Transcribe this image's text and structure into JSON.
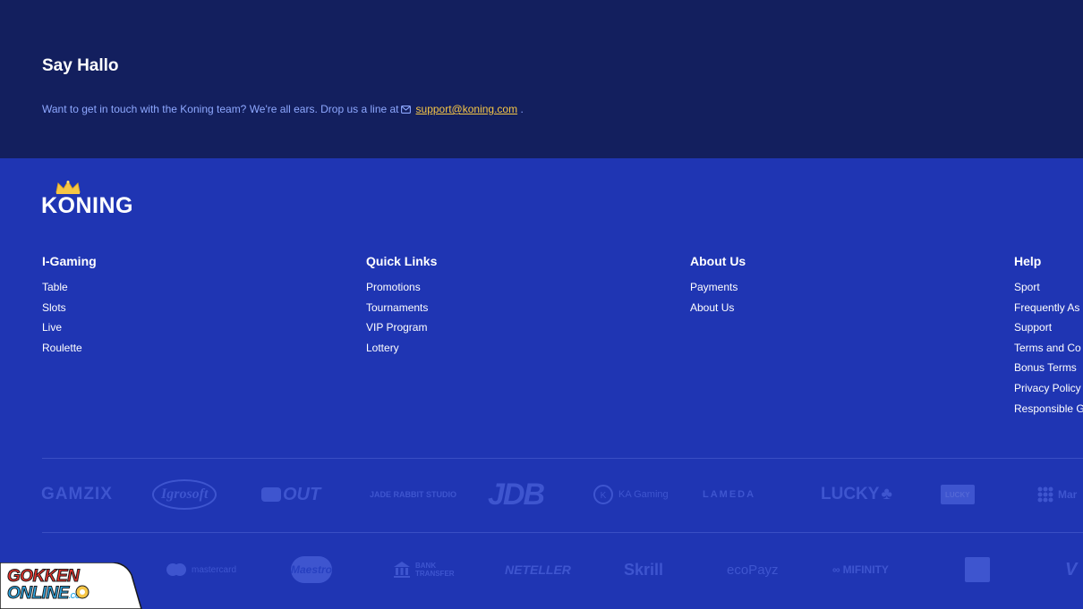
{
  "contact": {
    "title": "Say Hallo",
    "text": "Want to get in touch with the Koning team? We're all ears. Drop us a line at",
    "email": "support@koning.com",
    "suffix": "."
  },
  "brand": {
    "name": "KONING",
    "colors": {
      "dark_navy": "#131f5e",
      "footer_blue": "#1f35b3",
      "accent_gold": "#f6c646",
      "link_light": "#8ea8ff"
    }
  },
  "footer": {
    "columns": [
      {
        "title": "I-Gaming",
        "items": [
          "Table",
          "Slots",
          "Live",
          "Roulette"
        ]
      },
      {
        "title": "Quick Links",
        "items": [
          "Promotions",
          "Tournaments",
          "VIP Program",
          "Lottery"
        ]
      },
      {
        "title": "About Us",
        "items": [
          "Payments",
          "About Us"
        ]
      },
      {
        "title": "Help",
        "items": [
          "Sport",
          "Frequently As",
          "Support",
          "Terms and Co",
          "Bonus Terms",
          "Privacy Policy",
          "Responsible G"
        ]
      }
    ],
    "providers": [
      "GAMZIX",
      "Igrosoft",
      "OUT",
      "JADE RABBIT STUDIO",
      "JDB",
      "KA Gaming",
      "LAMEDA",
      "LUCKY",
      "LUCKY",
      "Mar"
    ],
    "payments": [
      "mastercard",
      "Maestro",
      "BANK TRANSFER",
      "NETELLER",
      "Skrill",
      "ecoPayz",
      "MIFINITY",
      "V"
    ]
  },
  "badge": {
    "line1": "GOKKEN",
    "line2": "ONLINE",
    "suffix": ".COM"
  }
}
